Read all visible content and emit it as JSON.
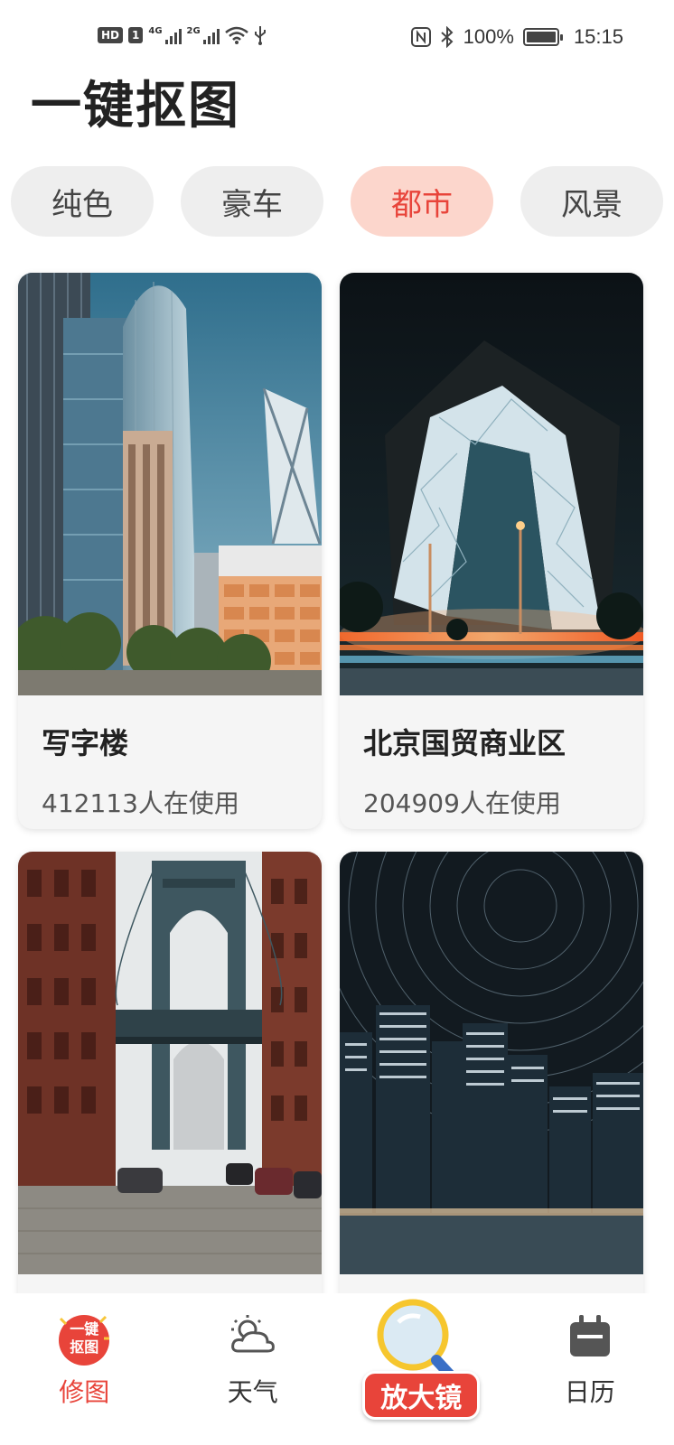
{
  "status_bar": {
    "hd_label": "HD",
    "sim_label": "1",
    "signal1_label": "4G",
    "signal2_label": "2G",
    "battery_percent": "100%",
    "time": "15:15"
  },
  "page": {
    "title": "一键抠图"
  },
  "categories": [
    {
      "label": "纯色",
      "active": false
    },
    {
      "label": "豪车",
      "active": false
    },
    {
      "label": "都市",
      "active": true
    },
    {
      "label": "风景",
      "active": false
    }
  ],
  "cards": [
    {
      "title": "写字楼",
      "usage": "412113人在使用"
    },
    {
      "title": "北京国贸商业区",
      "usage": "204909人在使用"
    },
    {
      "title": "",
      "usage": ""
    },
    {
      "title": "",
      "usage": ""
    }
  ],
  "bottom_nav": {
    "items": [
      {
        "label": "修图",
        "icon": "cutout-logo-icon",
        "badge_line1": "一键",
        "badge_line2": "抠图",
        "active": true
      },
      {
        "label": "天气",
        "icon": "weather-icon",
        "active": false
      },
      {
        "label": "放大镜",
        "icon": "magnifier-icon",
        "active": false
      },
      {
        "label": "日历",
        "icon": "calendar-icon",
        "active": false
      }
    ]
  },
  "colors": {
    "accent": "#e8443a",
    "active_tab_bg": "#fcd6cc",
    "inactive_tab_bg": "#eeeeee"
  }
}
